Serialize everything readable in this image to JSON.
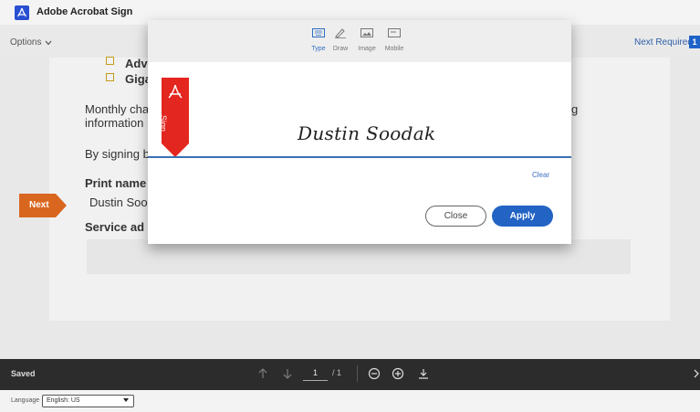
{
  "app": {
    "title": "Adobe Acrobat Sign",
    "logo_icon": "acrobat-logo-icon"
  },
  "toolbar": {
    "options_label": "Options",
    "next_required_label": "Next Required",
    "next_required_count": "1"
  },
  "document": {
    "list_item_1": "Adv",
    "list_item_2": "Giga",
    "paragraph_1_line_1": "Monthly cha",
    "paragraph_1_line_2": "information",
    "paragraph_1_trailing": "g",
    "paragraph_2": "By signing b",
    "print_name_label": "Print name",
    "print_name_value": "Dustin Soo",
    "service_address_label": "Service ad"
  },
  "next_tag": {
    "label": "Next",
    "color": "#d9661f"
  },
  "modal": {
    "tabs": [
      {
        "label": "Type",
        "icon": "keyboard-icon",
        "active": true
      },
      {
        "label": "Draw",
        "icon": "pen-icon",
        "active": false
      },
      {
        "label": "Image",
        "icon": "image-icon",
        "active": false
      },
      {
        "label": "Mobile",
        "icon": "mobile-icon",
        "active": false
      }
    ],
    "ribbon_label": "Sign",
    "ribbon_color": "#e3261f",
    "signature_value": "Dustin Soodak",
    "clear_label": "Clear",
    "close_label": "Close",
    "apply_label": "Apply",
    "accent_color": "#2263c4"
  },
  "bottombar": {
    "status": "Saved",
    "current_page": "1",
    "page_total": "/ 1"
  },
  "footer": {
    "language_label": "Language",
    "language_value": "English: US"
  }
}
